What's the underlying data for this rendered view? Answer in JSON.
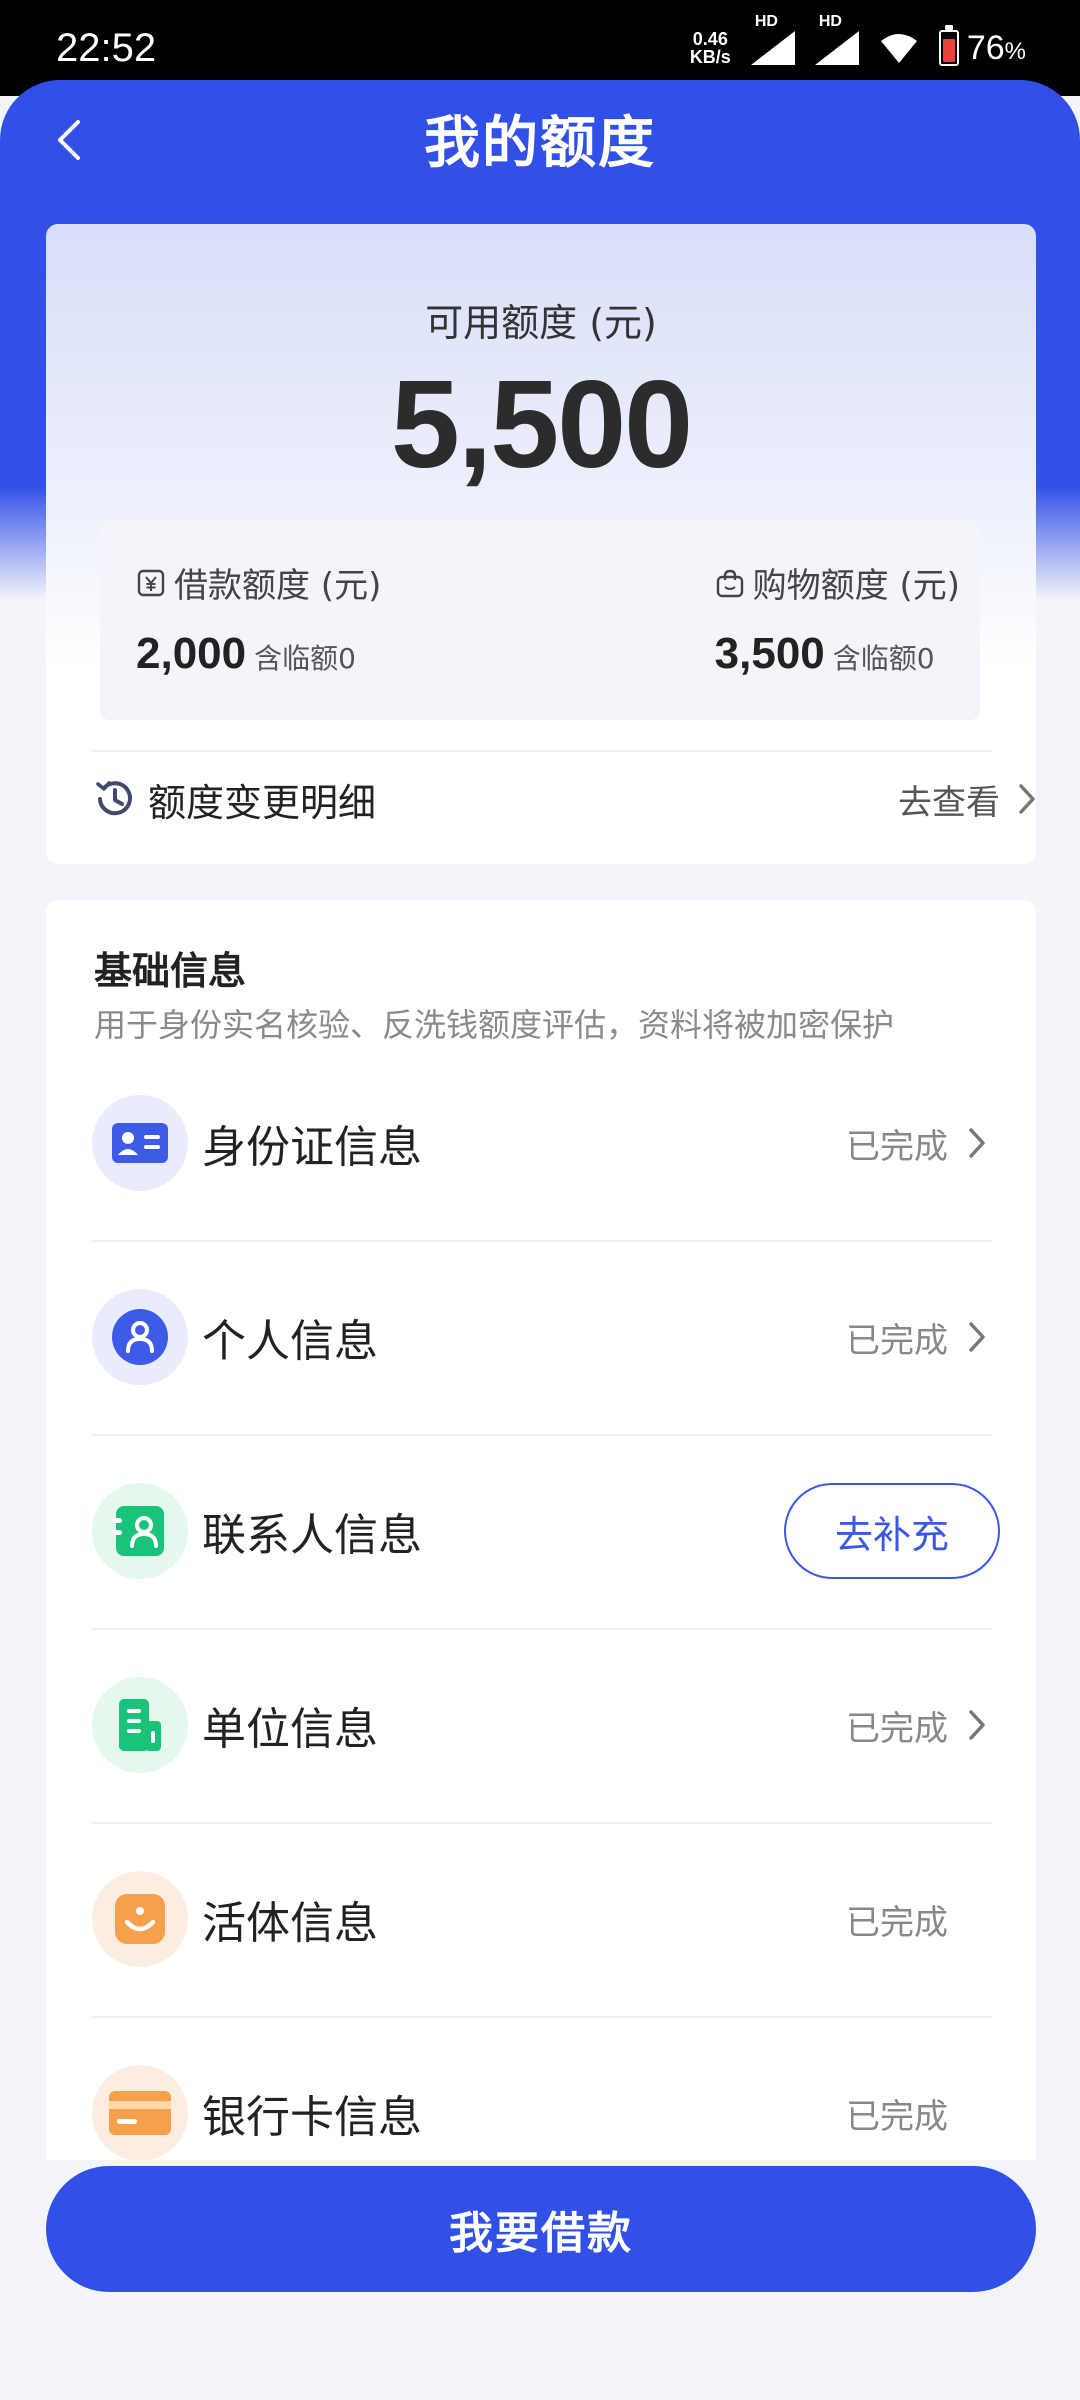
{
  "status_bar": {
    "time": "22:52",
    "net_speed_value": "0.46",
    "net_speed_unit": "KB/s",
    "hd1": "HD",
    "hd2": "HD",
    "battery": "76",
    "battery_unit": "%",
    "battery_level": 0.76
  },
  "header": {
    "title": "我的额度"
  },
  "quota": {
    "available_label": "可用额度 (元)",
    "available_value": "5,500",
    "loan_label": "借款额度 (元)",
    "loan_value": "2,000",
    "loan_note": "含临额0",
    "shopping_label": "购物额度 (元)",
    "shopping_value": "3,500",
    "shopping_note": "含临额0",
    "history_label": "额度变更明细",
    "history_action": "去查看"
  },
  "info": {
    "title": "基础信息",
    "subtitle": "用于身份实名核验、反洗钱额度评估，资料将被加密保护",
    "items": [
      {
        "label": "身份证信息",
        "status": "已完成",
        "icon": "id-card-icon"
      },
      {
        "label": "个人信息",
        "status": "已完成",
        "icon": "person-icon"
      },
      {
        "label": "联系人信息",
        "action": "去补充",
        "icon": "contacts-icon"
      },
      {
        "label": "单位信息",
        "status": "已完成",
        "icon": "building-icon"
      },
      {
        "label": "活体信息",
        "status": "已完成",
        "icon": "face-icon"
      },
      {
        "label": "银行卡信息",
        "status": "已完成",
        "icon": "bank-card-icon"
      }
    ]
  },
  "footer": {
    "borrow_label": "我要借款"
  },
  "colors": {
    "primary": "#3150E8",
    "outline_button": "#3B57E6",
    "battery_low": "#E8433C"
  }
}
